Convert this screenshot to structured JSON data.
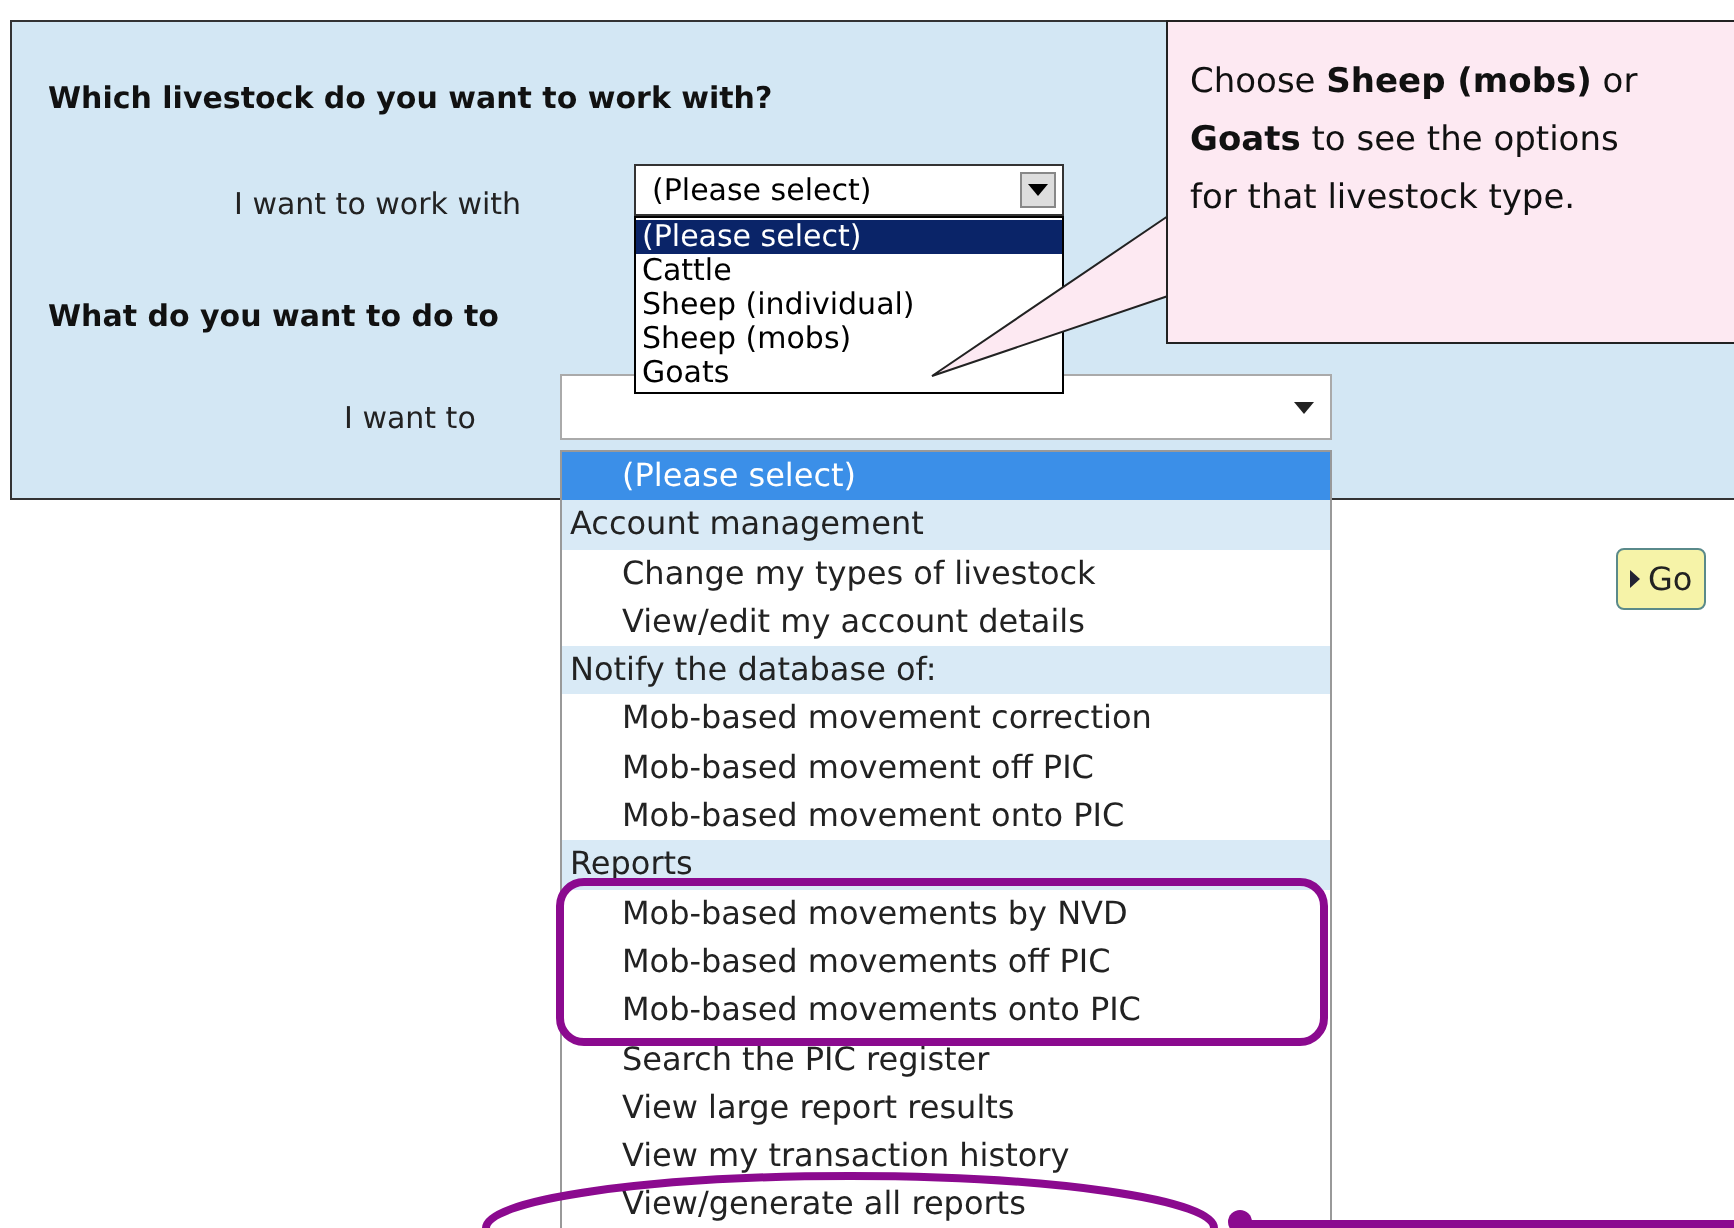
{
  "heading_livestock": "Which livestock do you want to work with?",
  "livestock_label": "I want to work with",
  "livestock_select": {
    "value": "(Please select)",
    "expanded": true,
    "options": [
      {
        "label": "(Please select)",
        "selected": true
      },
      {
        "label": "Cattle",
        "selected": false
      },
      {
        "label": "Sheep (individual)",
        "selected": false
      },
      {
        "label": "Sheep (mobs)",
        "selected": false
      },
      {
        "label": "Goats",
        "selected": false
      }
    ]
  },
  "heading_task": "What do you want to do to",
  "task_label": "I want to",
  "task_select": {
    "expanded": true,
    "options": [
      {
        "kind": "option",
        "label": "(Please select)",
        "selected": true
      },
      {
        "kind": "group",
        "label": "Account management"
      },
      {
        "kind": "option",
        "label": "Change my types of livestock",
        "selected": false
      },
      {
        "kind": "option",
        "label": "View/edit my account details",
        "selected": false
      },
      {
        "kind": "group",
        "label": "Notify the database of:"
      },
      {
        "kind": "option",
        "label": "Mob-based movement correction",
        "selected": false
      },
      {
        "kind": "option",
        "label": "Mob-based movement off PIC",
        "selected": false
      },
      {
        "kind": "option",
        "label": "Mob-based movement onto PIC",
        "selected": false
      },
      {
        "kind": "group",
        "label": "Reports"
      },
      {
        "kind": "option",
        "label": "Mob-based movements by NVD",
        "selected": false
      },
      {
        "kind": "option",
        "label": "Mob-based movements off PIC",
        "selected": false
      },
      {
        "kind": "option",
        "label": "Mob-based movements onto PIC",
        "selected": false
      },
      {
        "kind": "option",
        "label": "Search the PIC register",
        "selected": false
      },
      {
        "kind": "option",
        "label": "View large report results",
        "selected": false
      },
      {
        "kind": "option",
        "label": "View my transaction history",
        "selected": false
      },
      {
        "kind": "option",
        "label": "View/generate all reports",
        "selected": false
      }
    ]
  },
  "go_button": "Go",
  "callout": "Choose **Sheep (mobs)** or **Goats** to see the options for that livestock type."
}
